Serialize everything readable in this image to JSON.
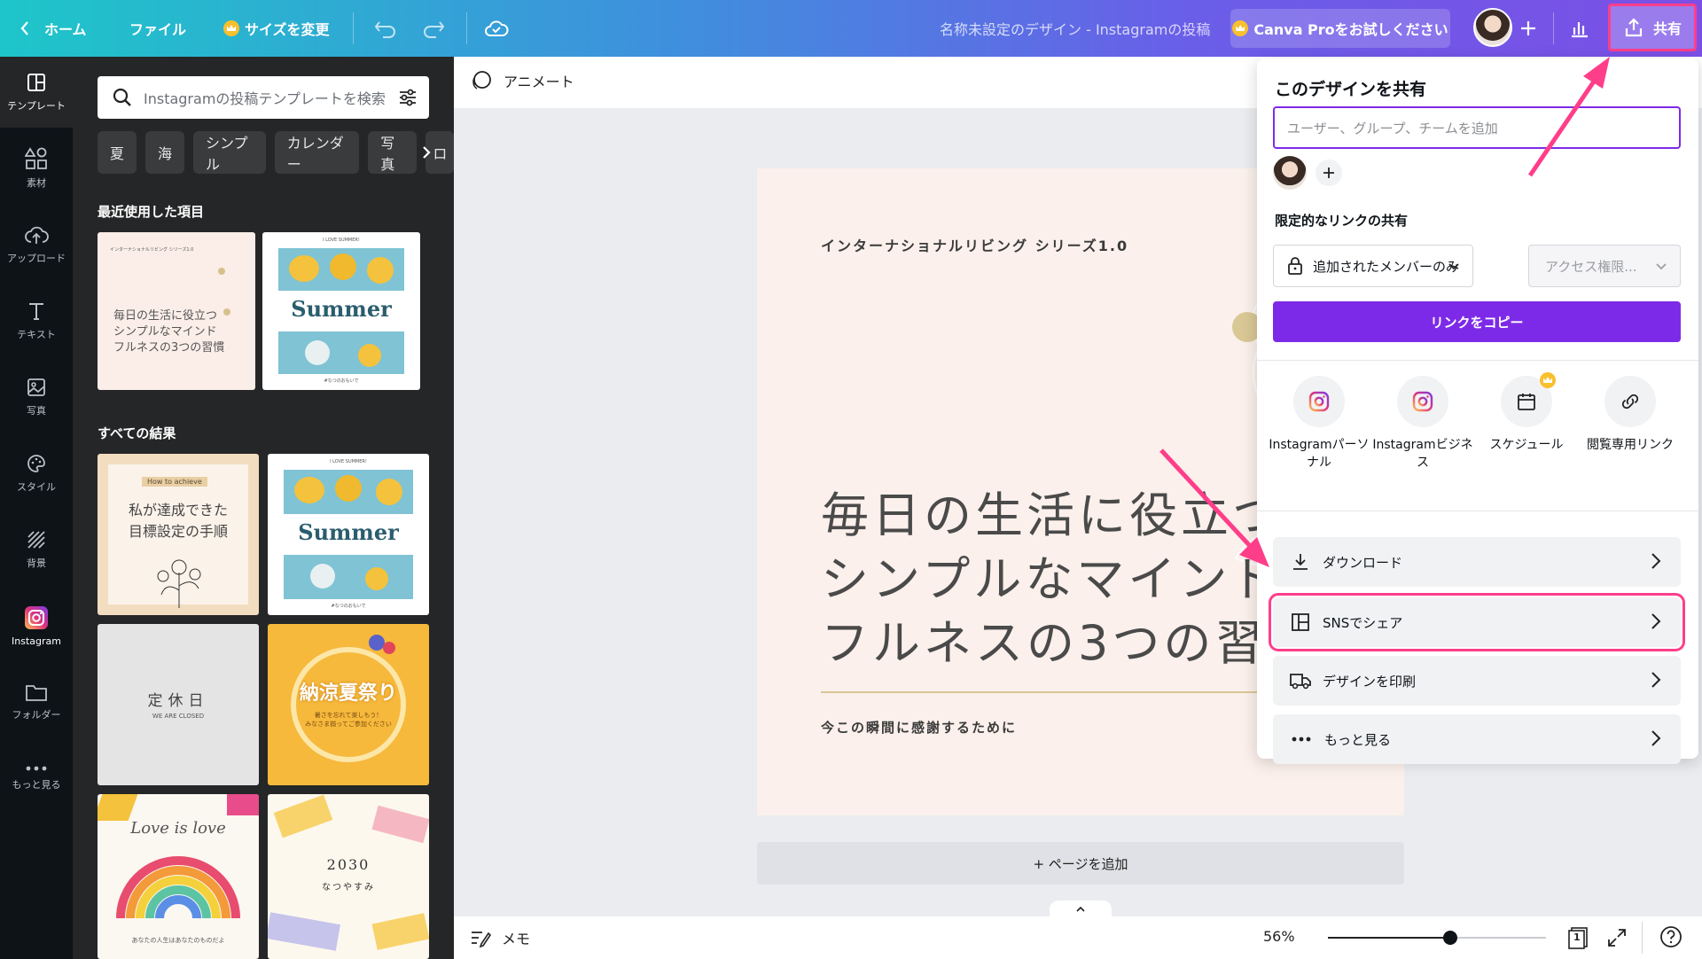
{
  "topbar": {
    "home": "ホーム",
    "file": "ファイル",
    "resize": "サイズを変更",
    "doc_title": "名称未設定のデザイン - Instagramの投稿",
    "pro": "Canva Proをお試しください",
    "share": "共有"
  },
  "rail": {
    "templates": "テンプレート",
    "elements": "素材",
    "uploads": "アップロード",
    "text": "テキスト",
    "photos": "写真",
    "styles": "スタイル",
    "background": "背景",
    "instagram": "Instagram",
    "folder": "フォルダー",
    "more": "もっと見る"
  },
  "panel": {
    "search_placeholder": "Instagramの投稿テンプレートを検索",
    "chips": [
      "夏",
      "海",
      "シンプル",
      "カレンダー",
      "写真",
      "ロ"
    ],
    "recent_title": "最近使用した項目",
    "results_title": "すべての結果",
    "thumb1_text": "毎日の生活に役立つ\nシンプルなマインド\nフルネスの3つの習慣",
    "thumb1_top": "インターナショナルリビング シリーズ1.0",
    "summer": "Summer",
    "summer_top": "I LOVE SUMMER!",
    "summer_bottom": "#なつのおもいで",
    "goal_badge": "How to achieve",
    "goal_text": "私が達成できた\n目標設定の手順",
    "closed_text": "定休日",
    "closed_sub": "WE ARE CLOSED",
    "festival": "納涼夏祭り",
    "festival_sub": "暑さを忘れて楽しもう！\nみなさま揃ってご参加ください",
    "love": "Love is love",
    "love_sub": "あなたの人生はあなたのものだよ",
    "year": "2030",
    "natsu": "なつやすみ"
  },
  "canvas": {
    "animate": "アニメート",
    "series": "インターナショナルリビング シリーズ1.0",
    "main_line1": "毎日の生活に役立つ",
    "main_line2": "シンプルなマインド",
    "main_line3": "フルネスの3つの習",
    "sub": "今この瞬間に感謝するために",
    "add_page": "+ ページを追加",
    "memo": "メモ",
    "zoom": "56%",
    "zoom_level": 0.56,
    "page_num": "1"
  },
  "share_panel": {
    "title": "このデザインを共有",
    "input_placeholder": "ユーザー、グループ、チームを追加",
    "limited_link": "限定的なリンクの共有",
    "members_only": "追加されたメンバーのみ",
    "access": "アクセス権限...",
    "copy_link": "リンクをコピー",
    "sns": [
      {
        "label": "Instagramパーソナル",
        "icon": "instagram-icon"
      },
      {
        "label": "Instagramビジネス",
        "icon": "instagram-icon"
      },
      {
        "label": "スケジュール",
        "icon": "calendar-icon"
      },
      {
        "label": "閲覧専用リンク",
        "icon": "link-icon"
      }
    ],
    "download": "ダウンロード",
    "sns_share": "SNSでシェア",
    "print": "デザインを印刷",
    "more": "もっと見る"
  },
  "colors": {
    "accent": "#7d2ae8",
    "highlight": "#ff3e8a",
    "page_bg": "#fbf0eb"
  }
}
